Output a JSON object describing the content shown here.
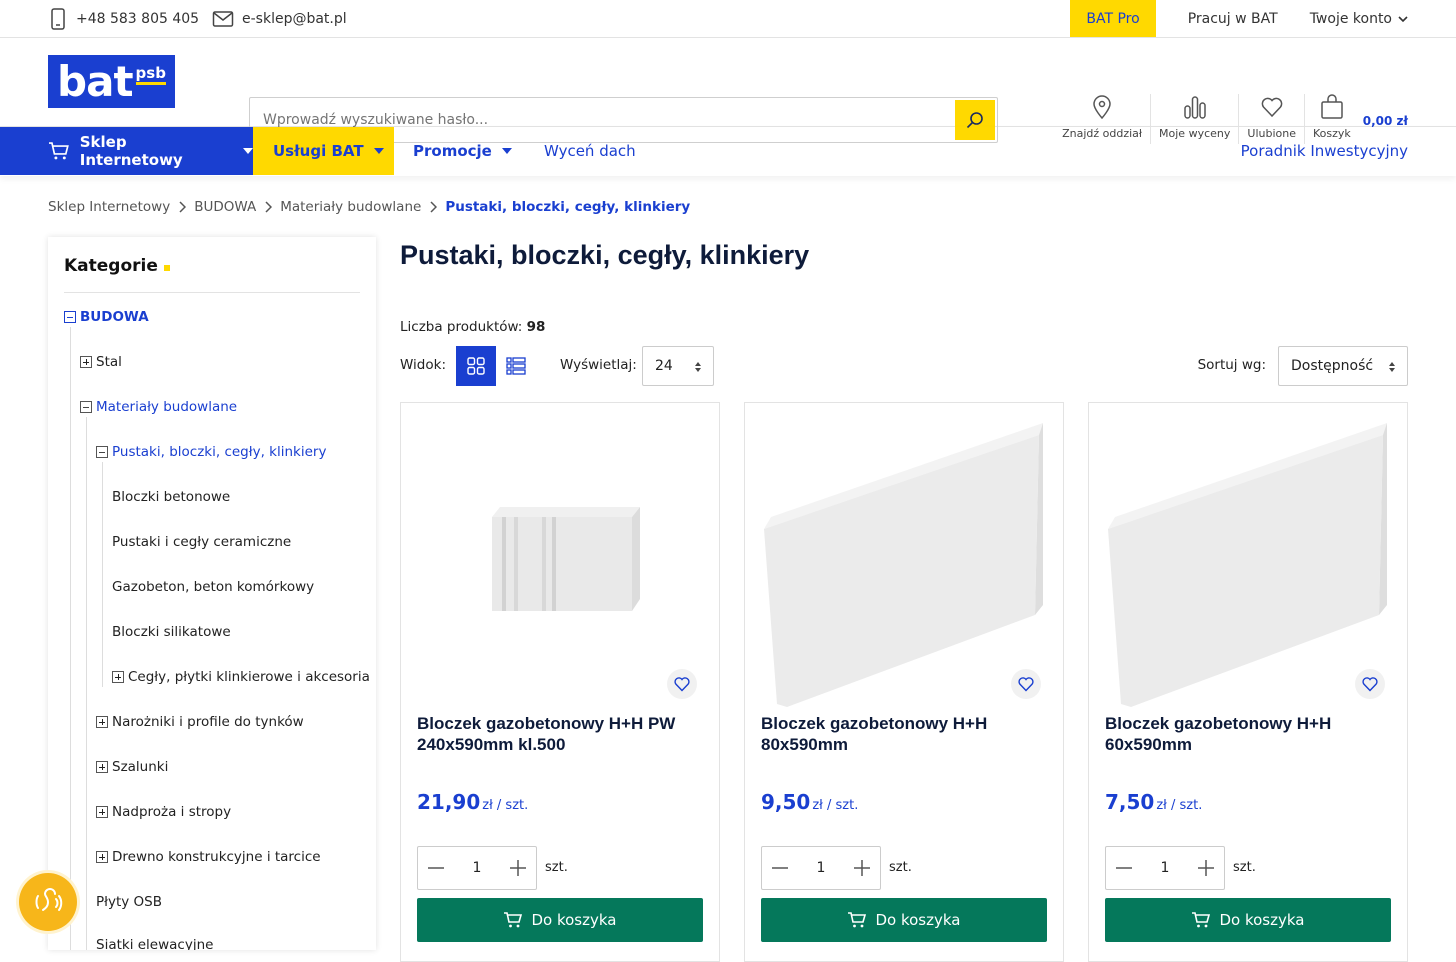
{
  "topbar": {
    "phone": "+48 583 805 405",
    "email": "e-sklep@bat.pl",
    "pro": "BAT Pro",
    "work": "Pracuj w BAT",
    "account": "Twoje konto"
  },
  "logo": {
    "text": "bat",
    "sub": "psb"
  },
  "search": {
    "placeholder": "Wprowadź wyszukiwane hasło..."
  },
  "header_icons": {
    "branch": "Znajdź oddział",
    "quotes": "Moje wyceny",
    "favorites": "Ulubione",
    "cart": "Koszyk",
    "cart_value": "0,00 zł"
  },
  "nav": {
    "shop": "Sklep Internetowy",
    "services": "Usługi BAT",
    "promo": "Promocje",
    "roof": "Wyceń dach",
    "guide": "Poradnik Inwestycyjny"
  },
  "breadcrumb": [
    "Sklep Internetowy",
    "BUDOWA",
    "Materiały budowlane",
    "Pustaki, bloczki, cegły, klinkiery"
  ],
  "sidebar": {
    "title": "Kategorie",
    "items": [
      {
        "label": "BUDOWA"
      },
      {
        "label": "Stal"
      },
      {
        "label": "Materiały budowlane"
      },
      {
        "label": "Pustaki, bloczki, cegły, klinkiery"
      },
      {
        "label": "Bloczki betonowe"
      },
      {
        "label": "Pustaki i cegły ceramiczne"
      },
      {
        "label": "Gazobeton, beton komórkowy"
      },
      {
        "label": "Bloczki silikatowe"
      },
      {
        "label": "Cegły, płytki klinkierowe i akcesoria"
      },
      {
        "label": "Narożniki i profile do tynków"
      },
      {
        "label": "Szalunki"
      },
      {
        "label": "Nadproża i stropy"
      },
      {
        "label": "Drewno konstrukcyjne i tarcice"
      },
      {
        "label": "Płyty OSB"
      },
      {
        "label": "Siatki elewacyjne"
      }
    ]
  },
  "main": {
    "title": "Pustaki, bloczki, cegły, klinkiery",
    "count_label": "Liczba produktów:",
    "count": "98",
    "view_label": "Widok:",
    "per_page_label": "Wyświetlaj:",
    "per_page": "24",
    "sort_label": "Sortuj wg:",
    "sort": "Dostępność"
  },
  "products": [
    {
      "name": "Bloczek gazobetonowy H+H PW 240x590mm kl.500",
      "price": "21,90",
      "unit_price": "zł / szt.",
      "qty": "1",
      "unit": "szt.",
      "add": "Do koszyka"
    },
    {
      "name": "Bloczek gazobetonowy H+H 80x590mm",
      "price": "9,50",
      "unit_price": "zł / szt.",
      "qty": "1",
      "unit": "szt.",
      "add": "Do koszyka"
    },
    {
      "name": "Bloczek gazobetonowy H+H 60x590mm",
      "price": "7,50",
      "unit_price": "zł / szt.",
      "qty": "1",
      "unit": "szt.",
      "add": "Do koszyka"
    }
  ],
  "colors": {
    "brand_blue": "#1a3fd0",
    "brand_yellow": "#ffd900",
    "cart_green": "#05785b",
    "accessibility": "#f7b61a"
  }
}
